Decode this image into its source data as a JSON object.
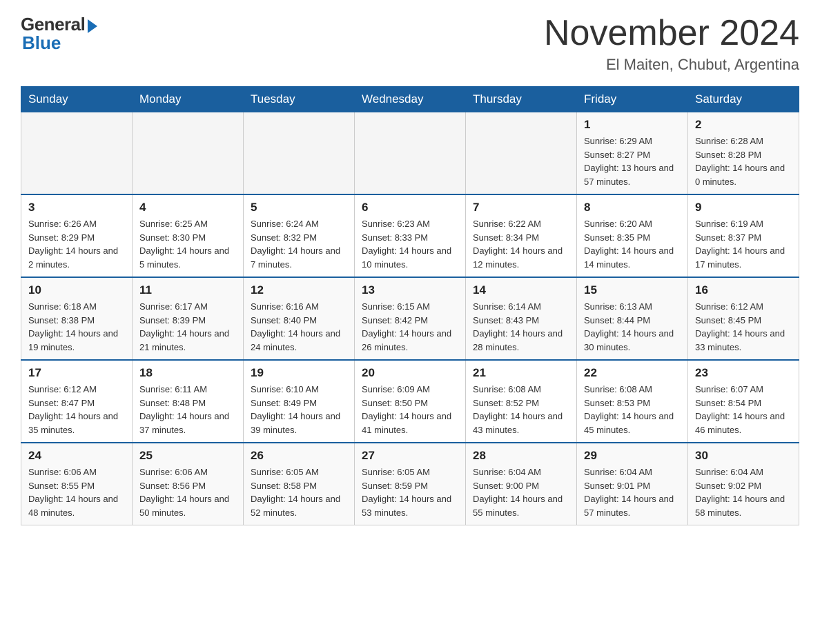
{
  "header": {
    "logo_general": "General",
    "logo_blue": "Blue",
    "title": "November 2024",
    "location": "El Maiten, Chubut, Argentina"
  },
  "days_of_week": [
    "Sunday",
    "Monday",
    "Tuesday",
    "Wednesday",
    "Thursday",
    "Friday",
    "Saturday"
  ],
  "weeks": [
    [
      {
        "day": "",
        "info": ""
      },
      {
        "day": "",
        "info": ""
      },
      {
        "day": "",
        "info": ""
      },
      {
        "day": "",
        "info": ""
      },
      {
        "day": "",
        "info": ""
      },
      {
        "day": "1",
        "info": "Sunrise: 6:29 AM\nSunset: 8:27 PM\nDaylight: 13 hours and 57 minutes."
      },
      {
        "day": "2",
        "info": "Sunrise: 6:28 AM\nSunset: 8:28 PM\nDaylight: 14 hours and 0 minutes."
      }
    ],
    [
      {
        "day": "3",
        "info": "Sunrise: 6:26 AM\nSunset: 8:29 PM\nDaylight: 14 hours and 2 minutes."
      },
      {
        "day": "4",
        "info": "Sunrise: 6:25 AM\nSunset: 8:30 PM\nDaylight: 14 hours and 5 minutes."
      },
      {
        "day": "5",
        "info": "Sunrise: 6:24 AM\nSunset: 8:32 PM\nDaylight: 14 hours and 7 minutes."
      },
      {
        "day": "6",
        "info": "Sunrise: 6:23 AM\nSunset: 8:33 PM\nDaylight: 14 hours and 10 minutes."
      },
      {
        "day": "7",
        "info": "Sunrise: 6:22 AM\nSunset: 8:34 PM\nDaylight: 14 hours and 12 minutes."
      },
      {
        "day": "8",
        "info": "Sunrise: 6:20 AM\nSunset: 8:35 PM\nDaylight: 14 hours and 14 minutes."
      },
      {
        "day": "9",
        "info": "Sunrise: 6:19 AM\nSunset: 8:37 PM\nDaylight: 14 hours and 17 minutes."
      }
    ],
    [
      {
        "day": "10",
        "info": "Sunrise: 6:18 AM\nSunset: 8:38 PM\nDaylight: 14 hours and 19 minutes."
      },
      {
        "day": "11",
        "info": "Sunrise: 6:17 AM\nSunset: 8:39 PM\nDaylight: 14 hours and 21 minutes."
      },
      {
        "day": "12",
        "info": "Sunrise: 6:16 AM\nSunset: 8:40 PM\nDaylight: 14 hours and 24 minutes."
      },
      {
        "day": "13",
        "info": "Sunrise: 6:15 AM\nSunset: 8:42 PM\nDaylight: 14 hours and 26 minutes."
      },
      {
        "day": "14",
        "info": "Sunrise: 6:14 AM\nSunset: 8:43 PM\nDaylight: 14 hours and 28 minutes."
      },
      {
        "day": "15",
        "info": "Sunrise: 6:13 AM\nSunset: 8:44 PM\nDaylight: 14 hours and 30 minutes."
      },
      {
        "day": "16",
        "info": "Sunrise: 6:12 AM\nSunset: 8:45 PM\nDaylight: 14 hours and 33 minutes."
      }
    ],
    [
      {
        "day": "17",
        "info": "Sunrise: 6:12 AM\nSunset: 8:47 PM\nDaylight: 14 hours and 35 minutes."
      },
      {
        "day": "18",
        "info": "Sunrise: 6:11 AM\nSunset: 8:48 PM\nDaylight: 14 hours and 37 minutes."
      },
      {
        "day": "19",
        "info": "Sunrise: 6:10 AM\nSunset: 8:49 PM\nDaylight: 14 hours and 39 minutes."
      },
      {
        "day": "20",
        "info": "Sunrise: 6:09 AM\nSunset: 8:50 PM\nDaylight: 14 hours and 41 minutes."
      },
      {
        "day": "21",
        "info": "Sunrise: 6:08 AM\nSunset: 8:52 PM\nDaylight: 14 hours and 43 minutes."
      },
      {
        "day": "22",
        "info": "Sunrise: 6:08 AM\nSunset: 8:53 PM\nDaylight: 14 hours and 45 minutes."
      },
      {
        "day": "23",
        "info": "Sunrise: 6:07 AM\nSunset: 8:54 PM\nDaylight: 14 hours and 46 minutes."
      }
    ],
    [
      {
        "day": "24",
        "info": "Sunrise: 6:06 AM\nSunset: 8:55 PM\nDaylight: 14 hours and 48 minutes."
      },
      {
        "day": "25",
        "info": "Sunrise: 6:06 AM\nSunset: 8:56 PM\nDaylight: 14 hours and 50 minutes."
      },
      {
        "day": "26",
        "info": "Sunrise: 6:05 AM\nSunset: 8:58 PM\nDaylight: 14 hours and 52 minutes."
      },
      {
        "day": "27",
        "info": "Sunrise: 6:05 AM\nSunset: 8:59 PM\nDaylight: 14 hours and 53 minutes."
      },
      {
        "day": "28",
        "info": "Sunrise: 6:04 AM\nSunset: 9:00 PM\nDaylight: 14 hours and 55 minutes."
      },
      {
        "day": "29",
        "info": "Sunrise: 6:04 AM\nSunset: 9:01 PM\nDaylight: 14 hours and 57 minutes."
      },
      {
        "day": "30",
        "info": "Sunrise: 6:04 AM\nSunset: 9:02 PM\nDaylight: 14 hours and 58 minutes."
      }
    ]
  ]
}
